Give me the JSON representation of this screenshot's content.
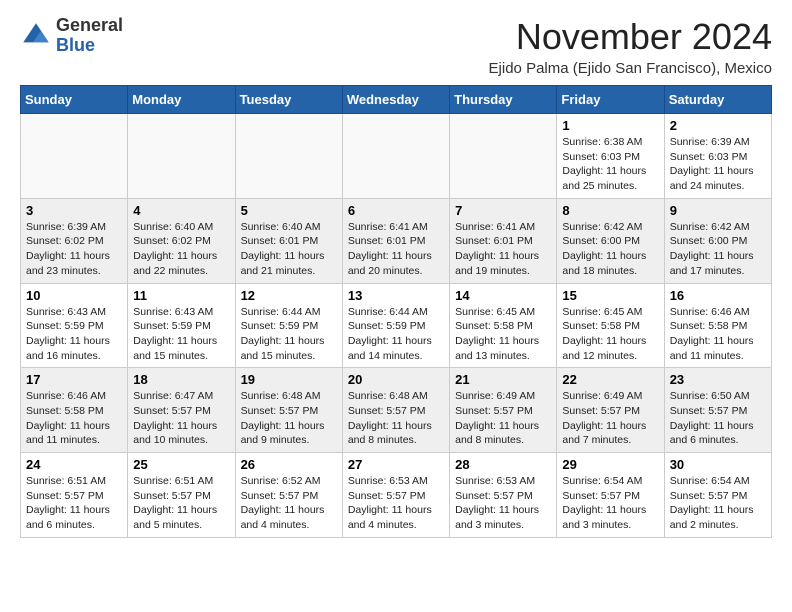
{
  "logo": {
    "general": "General",
    "blue": "Blue"
  },
  "header": {
    "month": "November 2024",
    "subtitle": "Ejido Palma (Ejido San Francisco), Mexico"
  },
  "weekdays": [
    "Sunday",
    "Monday",
    "Tuesday",
    "Wednesday",
    "Thursday",
    "Friday",
    "Saturday"
  ],
  "weeks": [
    [
      {
        "day": "",
        "info": ""
      },
      {
        "day": "",
        "info": ""
      },
      {
        "day": "",
        "info": ""
      },
      {
        "day": "",
        "info": ""
      },
      {
        "day": "",
        "info": ""
      },
      {
        "day": "1",
        "info": "Sunrise: 6:38 AM\nSunset: 6:03 PM\nDaylight: 11 hours and 25 minutes."
      },
      {
        "day": "2",
        "info": "Sunrise: 6:39 AM\nSunset: 6:03 PM\nDaylight: 11 hours and 24 minutes."
      }
    ],
    [
      {
        "day": "3",
        "info": "Sunrise: 6:39 AM\nSunset: 6:02 PM\nDaylight: 11 hours and 23 minutes."
      },
      {
        "day": "4",
        "info": "Sunrise: 6:40 AM\nSunset: 6:02 PM\nDaylight: 11 hours and 22 minutes."
      },
      {
        "day": "5",
        "info": "Sunrise: 6:40 AM\nSunset: 6:01 PM\nDaylight: 11 hours and 21 minutes."
      },
      {
        "day": "6",
        "info": "Sunrise: 6:41 AM\nSunset: 6:01 PM\nDaylight: 11 hours and 20 minutes."
      },
      {
        "day": "7",
        "info": "Sunrise: 6:41 AM\nSunset: 6:01 PM\nDaylight: 11 hours and 19 minutes."
      },
      {
        "day": "8",
        "info": "Sunrise: 6:42 AM\nSunset: 6:00 PM\nDaylight: 11 hours and 18 minutes."
      },
      {
        "day": "9",
        "info": "Sunrise: 6:42 AM\nSunset: 6:00 PM\nDaylight: 11 hours and 17 minutes."
      }
    ],
    [
      {
        "day": "10",
        "info": "Sunrise: 6:43 AM\nSunset: 5:59 PM\nDaylight: 11 hours and 16 minutes."
      },
      {
        "day": "11",
        "info": "Sunrise: 6:43 AM\nSunset: 5:59 PM\nDaylight: 11 hours and 15 minutes."
      },
      {
        "day": "12",
        "info": "Sunrise: 6:44 AM\nSunset: 5:59 PM\nDaylight: 11 hours and 15 minutes."
      },
      {
        "day": "13",
        "info": "Sunrise: 6:44 AM\nSunset: 5:59 PM\nDaylight: 11 hours and 14 minutes."
      },
      {
        "day": "14",
        "info": "Sunrise: 6:45 AM\nSunset: 5:58 PM\nDaylight: 11 hours and 13 minutes."
      },
      {
        "day": "15",
        "info": "Sunrise: 6:45 AM\nSunset: 5:58 PM\nDaylight: 11 hours and 12 minutes."
      },
      {
        "day": "16",
        "info": "Sunrise: 6:46 AM\nSunset: 5:58 PM\nDaylight: 11 hours and 11 minutes."
      }
    ],
    [
      {
        "day": "17",
        "info": "Sunrise: 6:46 AM\nSunset: 5:58 PM\nDaylight: 11 hours and 11 minutes."
      },
      {
        "day": "18",
        "info": "Sunrise: 6:47 AM\nSunset: 5:57 PM\nDaylight: 11 hours and 10 minutes."
      },
      {
        "day": "19",
        "info": "Sunrise: 6:48 AM\nSunset: 5:57 PM\nDaylight: 11 hours and 9 minutes."
      },
      {
        "day": "20",
        "info": "Sunrise: 6:48 AM\nSunset: 5:57 PM\nDaylight: 11 hours and 8 minutes."
      },
      {
        "day": "21",
        "info": "Sunrise: 6:49 AM\nSunset: 5:57 PM\nDaylight: 11 hours and 8 minutes."
      },
      {
        "day": "22",
        "info": "Sunrise: 6:49 AM\nSunset: 5:57 PM\nDaylight: 11 hours and 7 minutes."
      },
      {
        "day": "23",
        "info": "Sunrise: 6:50 AM\nSunset: 5:57 PM\nDaylight: 11 hours and 6 minutes."
      }
    ],
    [
      {
        "day": "24",
        "info": "Sunrise: 6:51 AM\nSunset: 5:57 PM\nDaylight: 11 hours and 6 minutes."
      },
      {
        "day": "25",
        "info": "Sunrise: 6:51 AM\nSunset: 5:57 PM\nDaylight: 11 hours and 5 minutes."
      },
      {
        "day": "26",
        "info": "Sunrise: 6:52 AM\nSunset: 5:57 PM\nDaylight: 11 hours and 4 minutes."
      },
      {
        "day": "27",
        "info": "Sunrise: 6:53 AM\nSunset: 5:57 PM\nDaylight: 11 hours and 4 minutes."
      },
      {
        "day": "28",
        "info": "Sunrise: 6:53 AM\nSunset: 5:57 PM\nDaylight: 11 hours and 3 minutes."
      },
      {
        "day": "29",
        "info": "Sunrise: 6:54 AM\nSunset: 5:57 PM\nDaylight: 11 hours and 3 minutes."
      },
      {
        "day": "30",
        "info": "Sunrise: 6:54 AM\nSunset: 5:57 PM\nDaylight: 11 hours and 2 minutes."
      }
    ]
  ]
}
